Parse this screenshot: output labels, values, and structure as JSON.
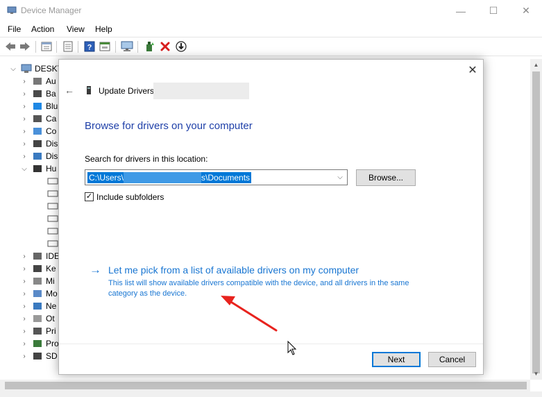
{
  "window": {
    "title": "Device Manager",
    "minimize_glyph": "—",
    "maximize_glyph": "☐",
    "close_glyph": "✕"
  },
  "menu": [
    "File",
    "Action",
    "View",
    "Help"
  ],
  "toolbar": {
    "icons": [
      "back-icon",
      "forward-icon",
      "properties-icon",
      "show-hidden-icon",
      "help-icon",
      "action-icon",
      "monitor-icon",
      "update-driver-icon",
      "uninstall-icon",
      "download-icon"
    ]
  },
  "tree": {
    "root_label": "DESKT",
    "items": [
      {
        "label": "Au",
        "icon": "audio-icon"
      },
      {
        "label": "Ba",
        "icon": "battery-icon"
      },
      {
        "label": "Blu",
        "icon": "bluetooth-icon"
      },
      {
        "label": "Ca",
        "icon": "camera-icon"
      },
      {
        "label": "Co",
        "icon": "computer-icon"
      },
      {
        "label": "Dis",
        "icon": "disk-icon"
      },
      {
        "label": "Dis",
        "icon": "display-icon"
      },
      {
        "label": "Hu",
        "icon": "hid-icon"
      },
      {
        "label": "IDE",
        "icon": "ide-icon"
      },
      {
        "label": "Ke",
        "icon": "keyboard-icon"
      },
      {
        "label": "Mi",
        "icon": "mouse-icon"
      },
      {
        "label": "Mo",
        "icon": "monitor-icon"
      },
      {
        "label": "Ne",
        "icon": "network-icon"
      },
      {
        "label": "Ot",
        "icon": "other-icon"
      },
      {
        "label": "Pri",
        "icon": "printer-icon"
      },
      {
        "label": "Pro",
        "icon": "processor-icon"
      },
      {
        "label": "SD",
        "icon": "sd-icon"
      }
    ]
  },
  "dialog": {
    "title": "Update Drivers",
    "heading": "Browse for drivers on your computer",
    "search_label": "Search for drivers in this location:",
    "path_prefix": "C:\\Users\\",
    "path_suffix": "s\\Documents",
    "browse_label": "Browse...",
    "include_subfolders_label": "Include subfolders",
    "include_subfolders_checked": true,
    "check_glyph": "✓",
    "pick_arrow_glyph": "→",
    "pick_title": "Let me pick from a list of available drivers on my computer",
    "pick_description": "This list will show available drivers compatible with the device, and all drivers in the same category as the device.",
    "next_label": "Next",
    "cancel_label": "Cancel",
    "close_glyph": "✕",
    "back_glyph": "←"
  },
  "colors": {
    "heading_blue": "#1e3fa8",
    "link_blue": "#1976d2",
    "selection_blue": "#0078d7",
    "annotation_red": "#e8231e"
  }
}
